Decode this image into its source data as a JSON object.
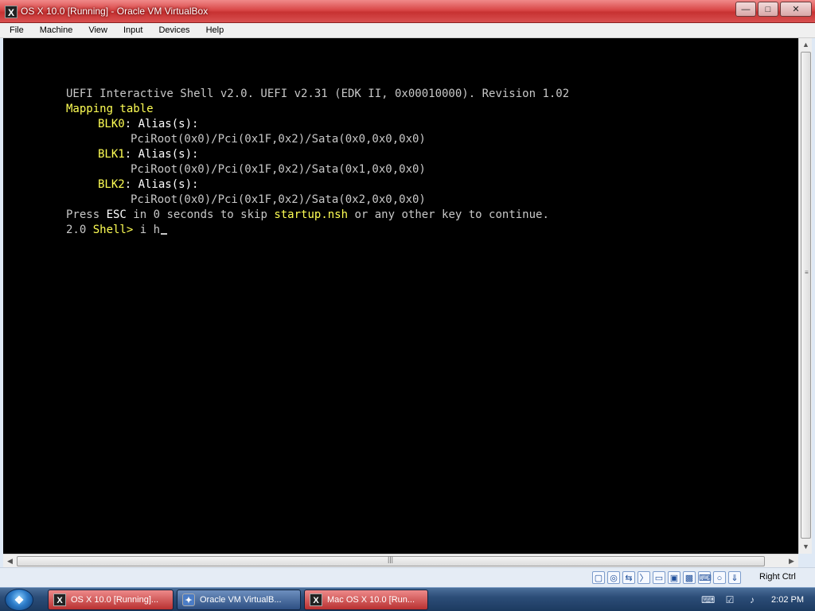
{
  "window": {
    "title": "OS X 10.0 [Running] - Oracle VM VirtualBox",
    "app_icon": "X",
    "controls": {
      "minimize": "minimize-icon",
      "maximize": "maximize-icon",
      "close": "close-icon"
    }
  },
  "menu": [
    "File",
    "Machine",
    "View",
    "Input",
    "Devices",
    "Help"
  ],
  "terminal": {
    "header": "UEFI Interactive Shell v2.0. UEFI v2.31 (EDK II, 0x00010000). Revision 1.02",
    "mapping_title": "Mapping table",
    "devices": [
      {
        "name": "BLK0",
        "label": ": Alias(s):",
        "path": "PciRoot(0x0)/Pci(0x1F,0x2)/Sata(0x0,0x0,0x0)"
      },
      {
        "name": "BLK1",
        "label": ": Alias(s):",
        "path": "PciRoot(0x0)/Pci(0x1F,0x2)/Sata(0x1,0x0,0x0)"
      },
      {
        "name": "BLK2",
        "label": ": Alias(s):",
        "path": "PciRoot(0x0)/Pci(0x1F,0x2)/Sata(0x2,0x0,0x0)"
      }
    ],
    "prompt_line": {
      "part1": "Press ",
      "esc": "ESC",
      "part2": " in 0 seconds to skip ",
      "startup": "startup.nsh",
      "part3": " or any other key to continue."
    },
    "shell_prefix": "2.0 ",
    "shell_prompt": "Shell>",
    "shell_input": " i h"
  },
  "statusbar": {
    "icons": [
      "hard-disk-icon",
      "optical-drive-icon",
      "network-icon",
      "usb-icon",
      "shared-folders-icon",
      "display-icon",
      "capture-icon",
      "keyboard-icon",
      "mouse-icon",
      "download-icon"
    ],
    "host_key": "Right Ctrl"
  },
  "taskbar": {
    "start": "start-orb",
    "tasks": [
      {
        "label": "OS X 10.0 [Running]...",
        "style": "red",
        "icon": "virtualbox-vm-icon"
      },
      {
        "label": "Oracle VM VirtualB...",
        "style": "blue",
        "icon": "virtualbox-icon"
      },
      {
        "label": "Mac OS X 10.0 [Run...",
        "style": "red",
        "icon": "virtualbox-vm-icon"
      }
    ],
    "clock": "2:02 PM"
  }
}
